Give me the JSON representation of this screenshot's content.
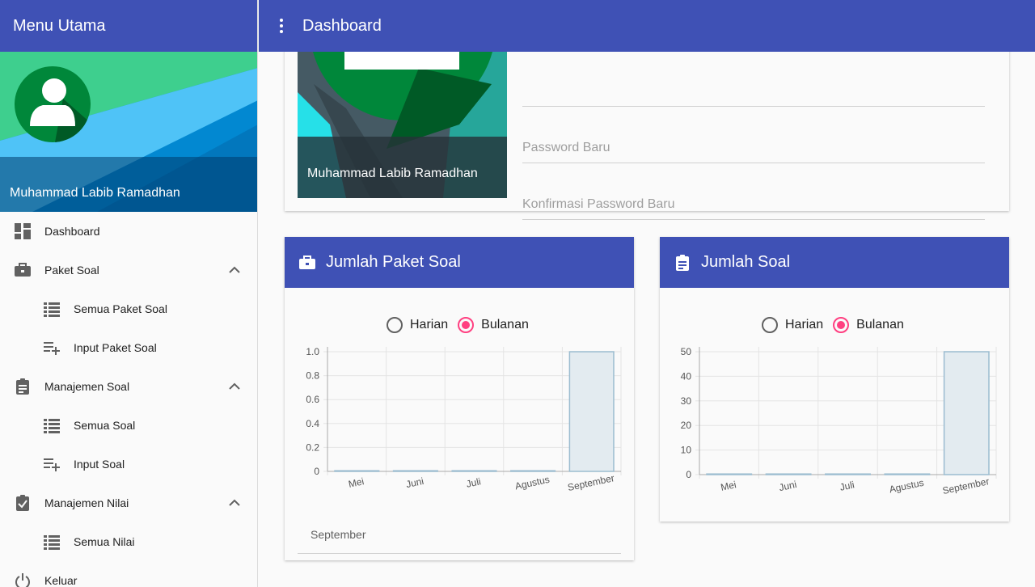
{
  "sidebar": {
    "title": "Menu Utama",
    "user_name": "Muhammad Labib Ramadhan",
    "items": [
      {
        "label": "Dashboard"
      },
      {
        "label": "Paket Soal"
      },
      {
        "label": "Semua Paket Soal"
      },
      {
        "label": "Input Paket Soal"
      },
      {
        "label": "Manajemen Soal"
      },
      {
        "label": "Semua Soal"
      },
      {
        "label": "Input Soal"
      },
      {
        "label": "Manajemen Nilai"
      },
      {
        "label": "Semua Nilai"
      },
      {
        "label": "Keluar"
      }
    ]
  },
  "topbar": {
    "title": "Dashboard"
  },
  "profile_card": {
    "name": "Muhammad Labib Ramadhan",
    "new_password_placeholder": "Password Baru",
    "confirm_password_placeholder": "Konfirmasi Password Baru"
  },
  "paket_card": {
    "title": "Jumlah Paket Soal",
    "radio_daily": "Harian",
    "radio_monthly": "Bulanan",
    "selected_month": "September"
  },
  "soal_card": {
    "title": "Jumlah Soal",
    "radio_daily": "Harian",
    "radio_monthly": "Bulanan"
  },
  "colors": {
    "primary": "#3f51b5",
    "accent": "#ff4081",
    "bar_stroke": "#9bbcd0",
    "bar_fill": "#e3ebf0"
  },
  "chart_data": [
    {
      "type": "bar",
      "categories": [
        "Mei",
        "Juni",
        "Juli",
        "Agustus",
        "September"
      ],
      "values": [
        0,
        0,
        0,
        0,
        1
      ],
      "yticks": [
        "0",
        "0.2",
        "0.4",
        "0.6",
        "0.8",
        "1.0"
      ],
      "ylim": [
        0,
        1
      ]
    },
    {
      "type": "bar",
      "categories": [
        "Mei",
        "Juni",
        "Juli",
        "Agustus",
        "September"
      ],
      "values": [
        0,
        0,
        0,
        0,
        50
      ],
      "yticks": [
        "0",
        "10",
        "20",
        "30",
        "40",
        "50"
      ],
      "ylim": [
        0,
        50
      ]
    }
  ]
}
